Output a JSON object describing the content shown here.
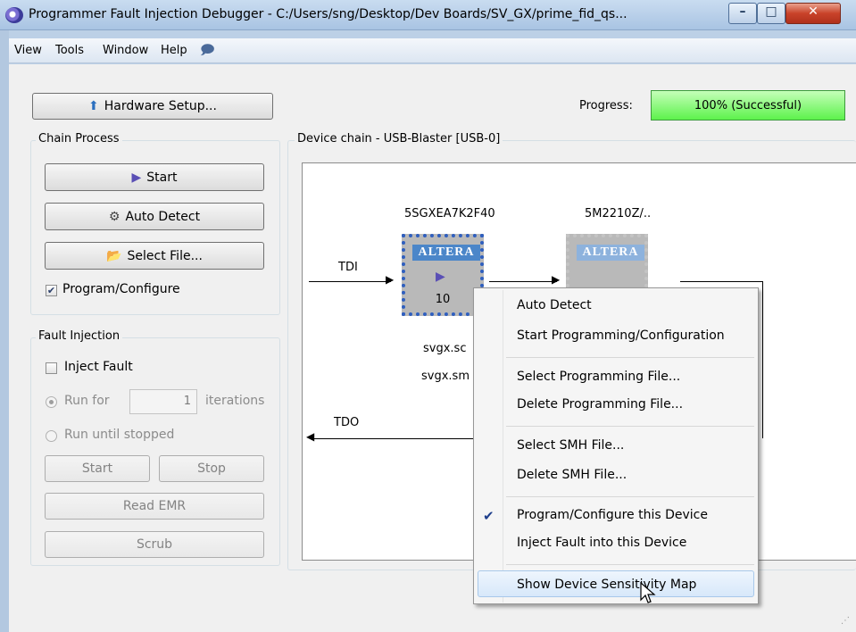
{
  "window": {
    "title": "Programmer Fault Injection Debugger - C:/Users/sng/Desktop/Dev Boards/SV_GX/prime_fid_qs...",
    "app_icon": "programmer-icon"
  },
  "menubar": {
    "items": [
      "View",
      "Tools",
      "Window",
      "Help"
    ],
    "help_icon": "speech-bubble-icon"
  },
  "toolbar": {
    "hardware_setup_label": "Hardware Setup...",
    "progress_label": "Progress:",
    "progress_value": "100% (Successful)",
    "progress_percent": 100,
    "progress_color": "#5df24c"
  },
  "chain_process": {
    "title": "Chain Process",
    "start_label": "Start",
    "auto_detect_label": "Auto Detect",
    "select_file_label": "Select File...",
    "program_configure_label": "Program/Configure",
    "program_configure_checked": true
  },
  "fault_injection": {
    "title": "Fault Injection",
    "inject_fault_label": "Inject Fault",
    "inject_fault_checked": false,
    "run_for_label": "Run for",
    "iterations_value": "1",
    "iterations_label": "iterations",
    "run_until_stopped_label": "Run until stopped",
    "start_label": "Start",
    "stop_label": "Stop",
    "read_emr_label": "Read EMR",
    "scrub_label": "Scrub"
  },
  "device_chain": {
    "title": "Device chain - USB-Blaster [USB-0]",
    "tdi_label": "TDI",
    "tdo_label": "TDO",
    "devices": [
      {
        "name": "5SGXEA7K2F40",
        "logo": "ALTERA",
        "number": "10",
        "file1": "svgx.sc",
        "file2": "svgx.sm"
      },
      {
        "name": "5M2210Z/..",
        "logo": "ALTERA"
      }
    ]
  },
  "context_menu": {
    "items": [
      "Auto Detect",
      "Start Programming/Configuration",
      "Select Programming File...",
      "Delete Programming File...",
      "Select SMH File...",
      "Delete SMH File...",
      "Program/Configure this Device",
      "Inject Fault into this Device",
      "Show Device Sensitivity Map"
    ],
    "checked_item": "Program/Configure this Device",
    "highlighted_item": "Show Device Sensitivity Map"
  }
}
